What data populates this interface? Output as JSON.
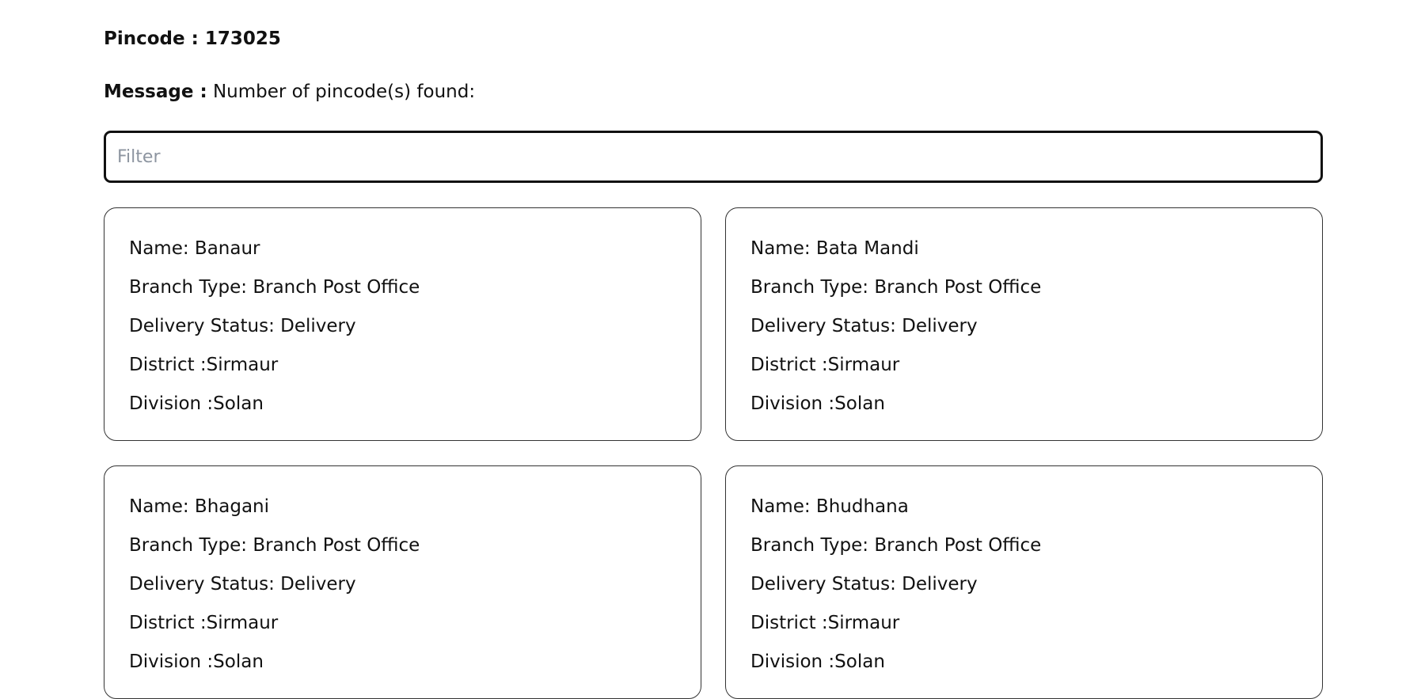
{
  "header": {
    "pincode_label": "Pincode : 173025",
    "message_label": "Message :",
    "message_text": "Number of pincode(s) found:"
  },
  "filter": {
    "placeholder": "Filter",
    "value": ""
  },
  "cards": [
    {
      "name": "Name: Banaur",
      "branch_type": "Branch Type: Branch Post Office",
      "delivery_status": "Delivery Status: Delivery",
      "district": "District :Sirmaur",
      "division": "Division :Solan"
    },
    {
      "name": "Name: Bata Mandi",
      "branch_type": "Branch Type: Branch Post Office",
      "delivery_status": "Delivery Status: Delivery",
      "district": "District :Sirmaur",
      "division": "Division :Solan"
    },
    {
      "name": "Name: Bhagani",
      "branch_type": "Branch Type: Branch Post Office",
      "delivery_status": "Delivery Status: Delivery",
      "district": "District :Sirmaur",
      "division": "Division :Solan"
    },
    {
      "name": "Name: Bhudhana",
      "branch_type": "Branch Type: Branch Post Office",
      "delivery_status": "Delivery Status: Delivery",
      "district": "District :Sirmaur",
      "division": "Division :Solan"
    }
  ]
}
